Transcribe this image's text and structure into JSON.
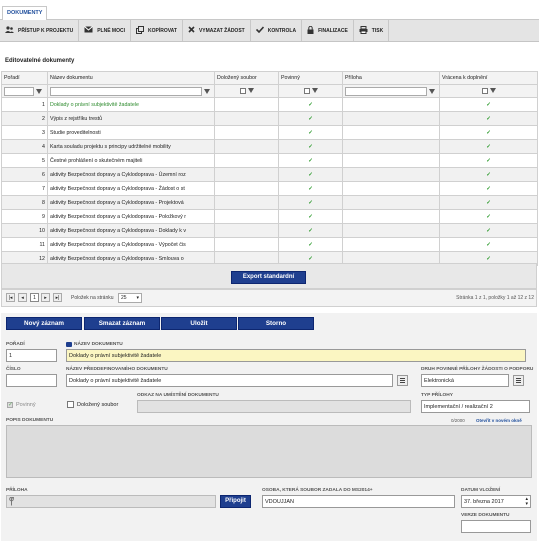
{
  "tab": "DOKUMENTY",
  "toolbar": [
    {
      "label": "PŘÍSTUP K PROJEKTU",
      "icon": "users-icon"
    },
    {
      "label": "PLNÉ MOCI",
      "icon": "envelope-icon"
    },
    {
      "label": "KOPÍROVAT",
      "icon": "copy-icon"
    },
    {
      "label": "VYMAZAT ŽÁDOST",
      "icon": "close-icon"
    },
    {
      "label": "KONTROLA",
      "icon": "check-icon"
    },
    {
      "label": "FINALIZACE",
      "icon": "lock-icon"
    },
    {
      "label": "TISK",
      "icon": "printer-icon"
    }
  ],
  "section_title": "Editovatelné dokumenty",
  "columns": [
    "Pořadí",
    "Název dokumentu",
    "Doložený soubor",
    "Povinný",
    "Příloha",
    "Vrácena k doplnění"
  ],
  "rows": [
    {
      "n": "1",
      "name": "Doklady o právní subjektivitě žadatele",
      "povinny": true,
      "vracena": true
    },
    {
      "n": "2",
      "name": "Výpis z rejstříku trestů",
      "povinny": true,
      "vracena": true
    },
    {
      "n": "3",
      "name": "Studie proveditelnosti",
      "povinny": true,
      "vracena": true
    },
    {
      "n": "4",
      "name": "Karta souladu projektu s principy udržitelné mobility",
      "povinny": true,
      "vracena": true
    },
    {
      "n": "5",
      "name": "Čestné prohlášení o skutečném majiteli",
      "povinny": true,
      "vracena": true
    },
    {
      "n": "6",
      "name": "aktivity Bezpečnost dopravy a Cyklodoprava - Územní roz",
      "povinny": true,
      "vracena": true
    },
    {
      "n": "7",
      "name": "aktivity Bezpečnost dopravy a Cyklodoprava - Žádost o st",
      "povinny": true,
      "vracena": true
    },
    {
      "n": "8",
      "name": "aktivity Bezpečnost dopravy a Cyklodoprava - Projektová",
      "povinny": true,
      "vracena": true
    },
    {
      "n": "9",
      "name": "aktivity Bezpečnost dopravy a Cyklodoprava - Položkový r",
      "povinny": true,
      "vracena": true
    },
    {
      "n": "10",
      "name": "aktivity Bezpečnost dopravy a Cyklodoprava - Doklady k v",
      "povinny": true,
      "vracena": true
    },
    {
      "n": "11",
      "name": "aktivity Bezpečnost dopravy a Cyklodoprava - Výpočet čis",
      "povinny": true,
      "vracena": true
    },
    {
      "n": "12",
      "name": "aktivity Bezpečnost dopravy a Cyklodoprava - Smlouva o",
      "povinny": true,
      "vracena": true
    }
  ],
  "export_label": "Export standardní",
  "pager": {
    "page": "1",
    "per_page_label": "Položek na stránku",
    "per_page": "25",
    "info": "Stránka 1 z 1, položky 1 až 12 z 12"
  },
  "buttons": {
    "new": "Nový záznam",
    "delete": "Smazat záznam",
    "save": "Uložit",
    "cancel": "Storno"
  },
  "form": {
    "poradi_label": "POŘADÍ",
    "poradi": "1",
    "nazev_label": "NÁZEV DOKUMENTU",
    "nazev": "Doklady o právní subjektivitě žadatele",
    "cislo_label": "ČÍSLO",
    "cislo": "",
    "predef_label": "NÁZEV PŘEDDEFINOVANÉHO DOKUMENTU",
    "predef": "Doklady o právní subjektivitě žadatele",
    "druh_label": "DRUH POVINNÉ PŘÍLOHY ŽÁDOSTI O PODPORU",
    "druh": "Elektronická",
    "povinny_label": "Povinný",
    "dolozeny_label": "Doložený soubor",
    "odkaz_label": "ODKAZ NA UMÍSTĚNÍ DOKUMENTU",
    "odkaz": "",
    "typ_label": "TYP PŘÍLOHY",
    "typ": "Implementační / realizační 2",
    "popis_label": "POPIS DOKUMENTU",
    "popis_count": "0/2000",
    "popis_link": "Otevřít v novém okně",
    "priloha_label": "PŘÍLOHA",
    "pripojit": "Připojit",
    "osoba_label": "OSOBA, KTERÁ SOUBOR ZADALA DO MS2014+",
    "osoba": "VDOUJJAN",
    "datum_label": "DATUM VLOŽENÍ",
    "datum": "37. března 2017",
    "verze_label": "VERZE DOKUMENTU",
    "verze": ""
  }
}
